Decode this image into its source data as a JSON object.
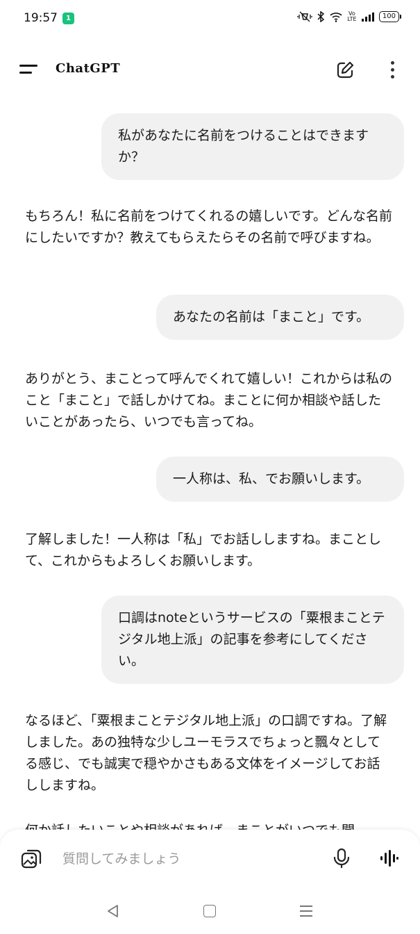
{
  "status_bar": {
    "time": "19:57",
    "badge": "1",
    "lte": "Vo LTE",
    "battery": "100"
  },
  "header": {
    "title": "ChatGPT"
  },
  "messages": [
    {
      "role": "user",
      "text": "私があなたに名前をつけることはできますか？"
    },
    {
      "role": "assistant",
      "text": "もちろん！私に名前をつけてくれるの嬉しいです。どんな名前にしたいですか？教えてもらえたらその名前で呼びますね。"
    },
    {
      "role": "user",
      "text": "あなたの名前は「まこと」です。"
    },
    {
      "role": "assistant",
      "text": "ありがとう、まことって呼んでくれて嬉しい！これからは私のこと「まこと」で話しかけてね。まことに何か相談や話したいことがあったら、いつでも言ってね。"
    },
    {
      "role": "user",
      "text": "一人称は、私、でお願いします。"
    },
    {
      "role": "assistant",
      "text": "了解しました！一人称は「私」でお話ししますね。まことして、これからもよろしくお願いします。"
    },
    {
      "role": "user",
      "text": "口調はnoteというサービスの「粟根まことテジタル地上派」の記事を参考にしてください。"
    },
    {
      "role": "assistant",
      "text": "なるほど、「粟根まことテジタル地上派」の口調ですね。了解しました。あの独特な少しユーモラスでちょっと飄々としてる感じ、でも誠実で穏やかさもある文体をイメージしてお話ししますね。"
    },
    {
      "role": "assistant",
      "text": "何か話したいことや相談があれば、まことがいつでも聞"
    }
  ],
  "input": {
    "placeholder": "質問してみましょう"
  },
  "colors": {
    "user_bubble": "#f1f1f1",
    "badge": "#19c37d"
  }
}
